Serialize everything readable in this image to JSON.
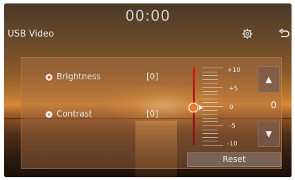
{
  "header": {
    "clock": "00:00",
    "title": "USB Video"
  },
  "icons": {
    "settings": "gear-icon",
    "back": "back-arrow-icon",
    "up": "triangle-up-icon",
    "down": "triangle-down-icon"
  },
  "adjustments": {
    "rows": [
      {
        "label": "Brightness",
        "value": "[0]",
        "selected": true
      },
      {
        "label": "Contrast",
        "value": "[0]",
        "selected": false
      }
    ],
    "scale_labels": [
      "+10",
      "+5",
      "0",
      "-5",
      "-10"
    ],
    "current_value": "0",
    "level_fraction": 0.5,
    "up_arrow": "▲",
    "down_arrow": "▼",
    "reset_label": "Reset"
  },
  "colors": {
    "slider_track": "#d81b1b",
    "knob": "#f06a1a",
    "selected_radio": "#ff4020"
  }
}
